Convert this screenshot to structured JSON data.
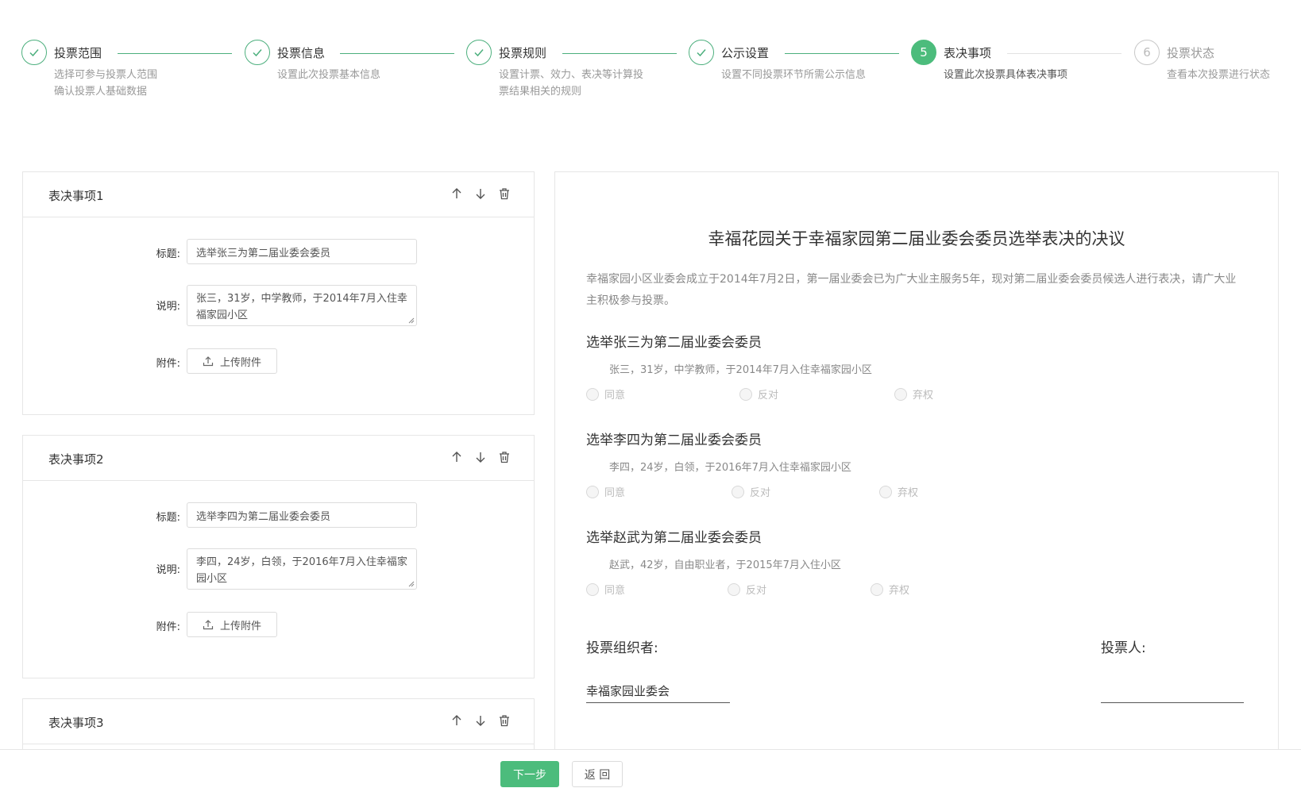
{
  "steps": [
    {
      "num": "1",
      "title": "投票范围",
      "desc1": "选择可参与投票人范围",
      "desc2": "确认投票人基础数据",
      "state": "done"
    },
    {
      "num": "2",
      "title": "投票信息",
      "desc1": "设置此次投票基本信息",
      "desc2": "",
      "state": "done"
    },
    {
      "num": "3",
      "title": "投票规则",
      "desc1": "设置计票、效力、表决等计算投",
      "desc2": "票结果相关的规则",
      "state": "done"
    },
    {
      "num": "4",
      "title": "公示设置",
      "desc1": "设置不同投票环节所需公示信息",
      "desc2": "",
      "state": "done"
    },
    {
      "num": "5",
      "title": "表决事项",
      "desc1": "设置此次投票具体表决事项",
      "desc2": "",
      "state": "active"
    },
    {
      "num": "6",
      "title": "投票状态",
      "desc1": "查看本次投票进行状态",
      "desc2": "",
      "state": "todo"
    }
  ],
  "labels": {
    "title": "标题:",
    "desc": "说明:",
    "attach": "附件:",
    "upload": "上传附件"
  },
  "items": [
    {
      "header": "表决事项1",
      "title": "选举张三为第二届业委会委员",
      "desc": "张三，31岁，中学教师，于2014年7月入住幸福家园小区"
    },
    {
      "header": "表决事项2",
      "title": "选举李四为第二届业委会委员",
      "desc": "李四，24岁，白领，于2016年7月入住幸福家园小区"
    },
    {
      "header": "表决事项3",
      "title": "",
      "desc": ""
    }
  ],
  "preview": {
    "title": "幸福花园关于幸福家园第二届业委会委员选举表决的决议",
    "intro": "幸福家园小区业委会成立于2014年7月2日，第一届业委会已为广大业主服务5年，现对第二届业委会委员候选人进行表决，请广大业主积极参与投票。",
    "items": [
      {
        "title": "选举张三为第二届业委会委员",
        "desc": "张三，31岁，中学教师，于2014年7月入住幸福家园小区"
      },
      {
        "title": "选举李四为第二届业委会委员",
        "desc": "李四，24岁，白领，于2016年7月入住幸福家园小区"
      },
      {
        "title": "选举赵武为第二届业委会委员",
        "desc": "赵武，42岁，自由职业者，于2015年7月入住小区"
      }
    ],
    "options": {
      "agree": "同意",
      "oppose": "反对",
      "abstain": "弃权"
    },
    "organizer_label": "投票组织者:",
    "organizer_value": "幸福家园业委会",
    "voter_label": "投票人:",
    "voter_value": ""
  },
  "footer": {
    "next": "下一步",
    "back": "返 回"
  },
  "colors": {
    "accent": "#4cbc7c",
    "border": "#e6e6e6"
  }
}
